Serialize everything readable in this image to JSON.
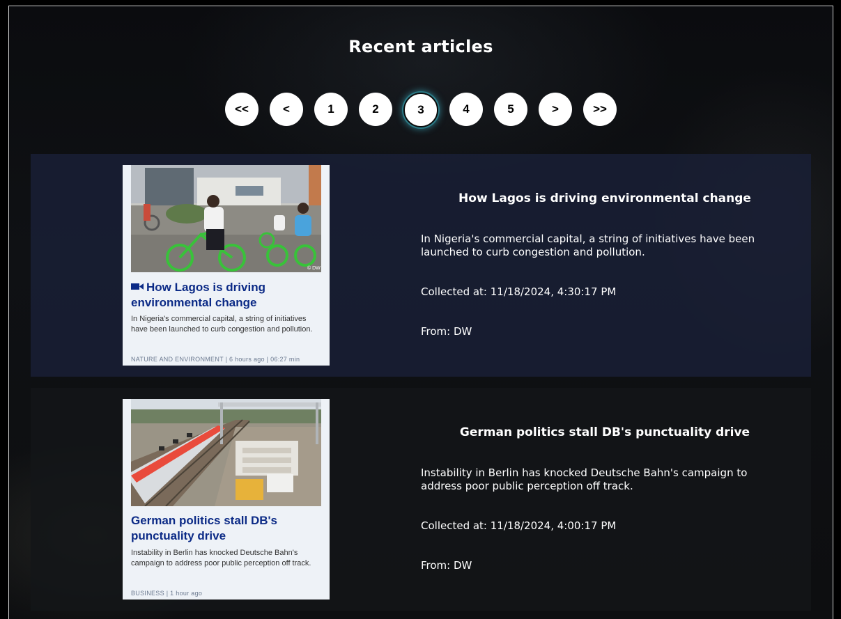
{
  "page": {
    "title": "Recent articles"
  },
  "pagination": {
    "first": "<<",
    "prev": "<",
    "pages": [
      "1",
      "2",
      "3",
      "4",
      "5"
    ],
    "current": "3",
    "next": ">",
    "last": ">>"
  },
  "articles": [
    {
      "title": "How Lagos is driving environmental change",
      "description": "In Nigeria's commercial capital, a string of initiatives have been launched to curb congestion and pollution.",
      "collected": "Collected at: 11/18/2024, 4:30:17 PM",
      "source": "From: DW",
      "thumb": {
        "title": "How Lagos is driving environmental change",
        "description": "In Nigeria's commercial capital, a string of initiatives have been launched to curb congestion and pollution.",
        "meta": "NATURE AND ENVIRONMENT  |  6 hours ago  |  06:27 min",
        "icon": "video-camera-icon",
        "credit": "© DW"
      }
    },
    {
      "title": "German politics stall DB's punctuality drive",
      "description": "Instability in Berlin has knocked Deutsche Bahn's campaign to address poor public perception off track.",
      "collected": "Collected at: 11/18/2024, 4:00:17 PM",
      "source": "From: DW",
      "thumb": {
        "title": "German politics stall DB's punctuality drive",
        "description": "Instability in Berlin has knocked Deutsche Bahn's campaign to address poor public perception off track.",
        "meta": "BUSINESS  |  1 hour ago"
      }
    }
  ],
  "colors": {
    "thumb_title": "#0b2a86",
    "active_glow": "#3aa9be",
    "card1_bg": "#1a2037",
    "card2_bg": "#141618"
  }
}
